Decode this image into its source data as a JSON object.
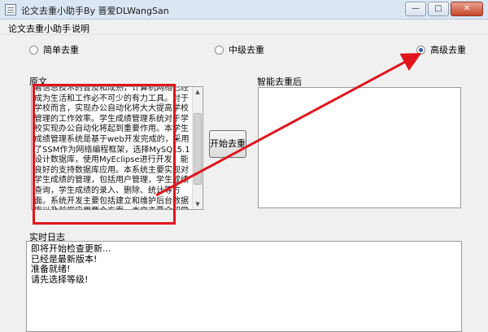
{
  "window": {
    "title": "论文去重小助手By 晋爱DLWangSan",
    "controls": [
      "—",
      "□",
      "✕"
    ]
  },
  "menu": {
    "items": [
      "论文去重小助手",
      "说明"
    ]
  },
  "modes": {
    "simple": "简单去重",
    "medium": "中级去重",
    "advanced": "高级去重",
    "selected": "advanced"
  },
  "original": {
    "label": "原文",
    "text": "着信息技术的普及和成熟，计算机网络已经成为生活和工作必不可少的有力工具。对于学校而言，实现办公自动化将大大提高学校管理的工作效率。学生成绩管理系统对于学校实现办公自动化将起到重要作用。本学生成绩管理系统是基于web开发完成的，采用了SSM作为网络编程框架，选择MySQL5.1设计数据库，使用MyEclipse进行开发，能良好的支持数据库应用。本系统主要实现对学生成绩的管理，包括用户管理，学生成绩查询，学生成绩的录入、删除、统计等方面。系统开发主要包括建立和维护后台数据库以及前端应用两个方面。本文主要介绍学生成绩管理系统的可行性分析、需求分析、系统设计和系统实现等"
  },
  "smart_result": {
    "label": "智能去重后",
    "text": ""
  },
  "start_button": {
    "label": "开始去重"
  },
  "log": {
    "label": "实时日志",
    "lines": "即将开始检查更新...\n已经是最新版本!\n准备就绪!\n请先选择等级!"
  },
  "annotation_color": "#e0141b"
}
